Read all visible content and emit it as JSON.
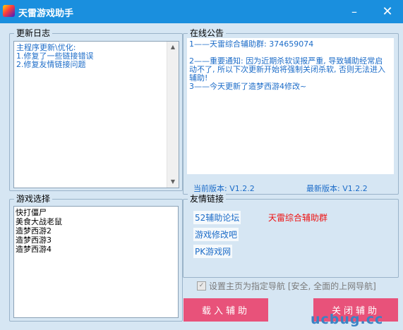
{
  "window": {
    "title": "天雷游戏助手",
    "minimize_glyph": "–",
    "close_glyph": "✕"
  },
  "changelog": {
    "title": "更新日志",
    "lines": [
      "主程序更新\\优化:",
      "1.修复了一些链接错误",
      "2.修复友情链接问题"
    ]
  },
  "notice": {
    "title": "在线公告",
    "lines": [
      "1——天雷综合辅助群: 374659074",
      "",
      "2——重要通知: 因为近期杀软误报严重, 导致辅助经常启动不了, 所以下次更新开始将强制关闭杀软, 否则无法进入辅助!",
      "3——今天更新了造梦西游4修改~"
    ],
    "current_version_label": "当前版本: V1.2.2",
    "latest_version_label": "最新版本: V1.2.2"
  },
  "game_select": {
    "title": "游戏选择",
    "items": [
      "快打僵尸",
      "美食大战老鼠",
      "造梦西游2",
      "造梦西游3",
      "造梦西游4"
    ]
  },
  "friend_links": {
    "title": "友情链接",
    "links": [
      "52辅助论坛",
      "天雷综合辅助群",
      "游戏修改吧",
      "PK游戏网"
    ]
  },
  "options": {
    "set_homepage_label": "设置主页为指定导航 [安全, 全面的上网导航]",
    "set_homepage_checked": true
  },
  "actions": {
    "load_label": "载入辅助",
    "close_label": "关闭辅助"
  },
  "watermark": "ucbug.cc",
  "icons": [
    "app-icon",
    "minimize-icon",
    "close-icon",
    "scroll-up-icon",
    "scroll-down-icon",
    "checkbox-check-icon"
  ],
  "colors": {
    "titlebar": "#1a8fde",
    "background": "#d6e6f3",
    "accent_text": "#1c6cc8",
    "button": "#e8527a",
    "link_red": "#ee1111"
  }
}
